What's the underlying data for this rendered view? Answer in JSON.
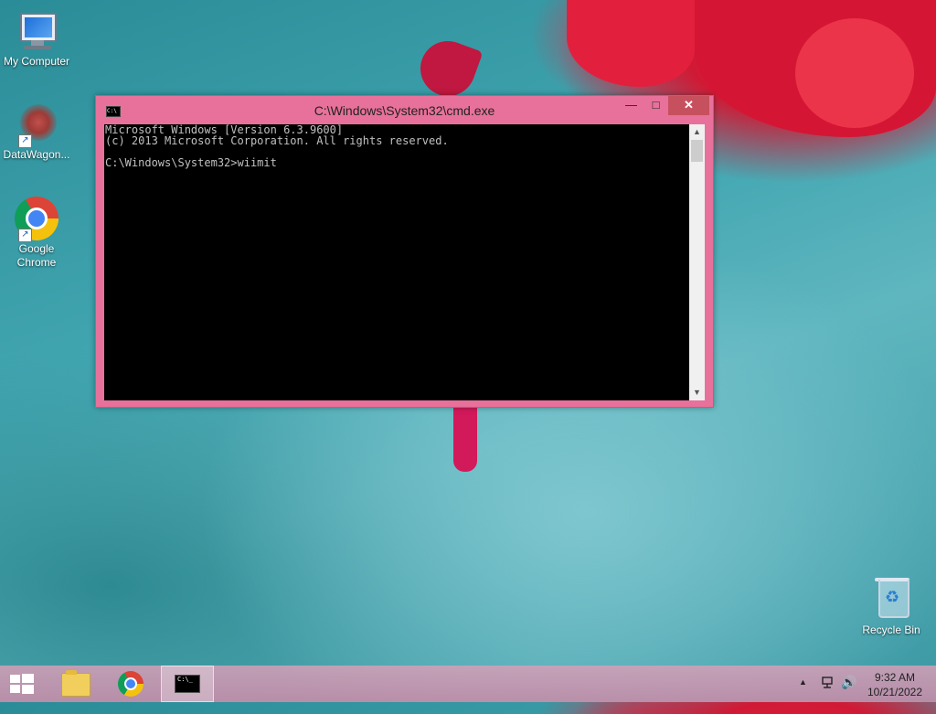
{
  "desktop": {
    "icons": [
      {
        "label": "My Computer",
        "icon": "computer-icon"
      },
      {
        "label": "DataWagon...",
        "icon": "datawagon-icon"
      },
      {
        "label": "Google Chrome",
        "icon": "chrome-icon"
      },
      {
        "label": "Recycle Bin",
        "icon": "recycle-bin-icon"
      }
    ]
  },
  "window": {
    "title": "C:\\Windows\\System32\\cmd.exe",
    "controls": {
      "minimize": "—",
      "maximize": "□",
      "close": "✕"
    },
    "console_lines": [
      "Microsoft Windows [Version 6.3.9600]",
      "(c) 2013 Microsoft Corporation. All rights reserved.",
      "",
      "C:\\Windows\\System32>wiimit"
    ]
  },
  "taskbar": {
    "buttons": [
      {
        "name": "file-explorer",
        "icon": "folder-icon"
      },
      {
        "name": "google-chrome",
        "icon": "chrome-icon"
      },
      {
        "name": "command-prompt",
        "icon": "cmd-icon",
        "active": true
      }
    ],
    "tray": {
      "time": "9:32 AM",
      "date": "10/21/2022"
    }
  },
  "colors": {
    "window_frame": "#e7719a",
    "close_button": "#c7505f",
    "console_bg": "#000000",
    "console_text": "#c0c0c0"
  }
}
